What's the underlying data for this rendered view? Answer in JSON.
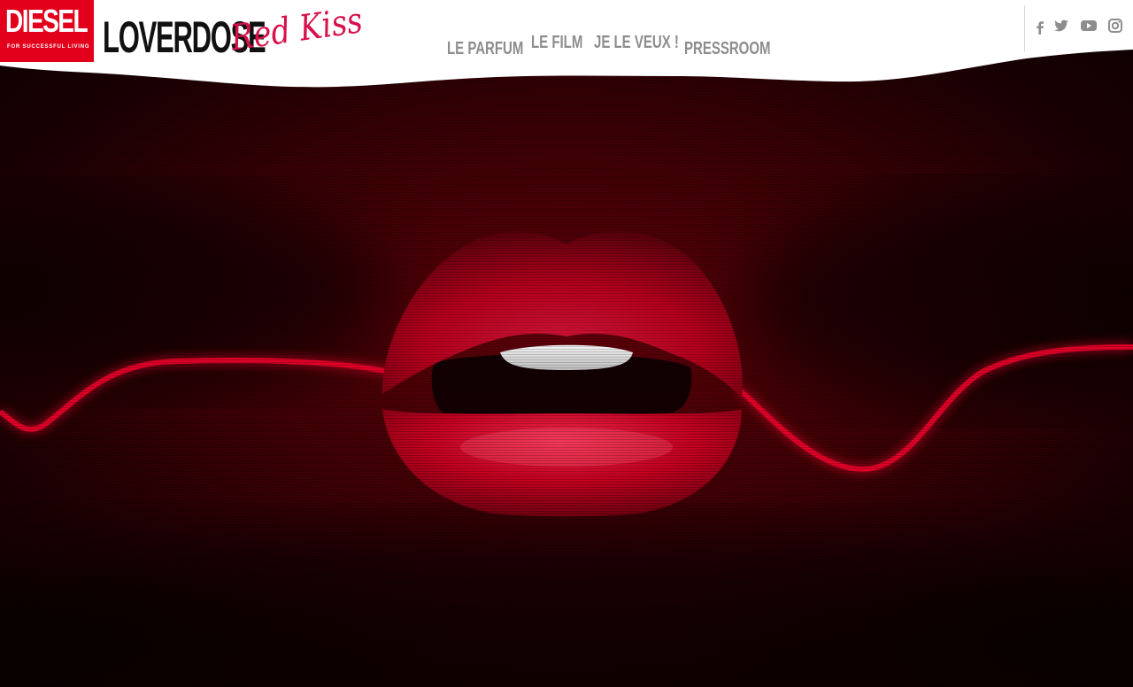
{
  "brand": {
    "logo_word": "DIESEL",
    "logo_tagline": "FOR SUCCESSFUL LIVING",
    "title": "LOVERDOSE",
    "script": "Red Kiss"
  },
  "nav": {
    "items": [
      {
        "label": "LE PARFUM"
      },
      {
        "label": "LE FILM"
      },
      {
        "label": "JE LE VEUX !"
      },
      {
        "label": "PRESSROOM"
      }
    ]
  },
  "social": {
    "icons": [
      "facebook-icon",
      "twitter-icon",
      "youtube-icon",
      "instagram-icon"
    ]
  },
  "colors": {
    "brand_red": "#e3001b",
    "script_pink": "#d8104a",
    "nav_gray": "#8d8d8d",
    "background_dark_red": "#3a0005",
    "lip_red": "#b5001c"
  }
}
